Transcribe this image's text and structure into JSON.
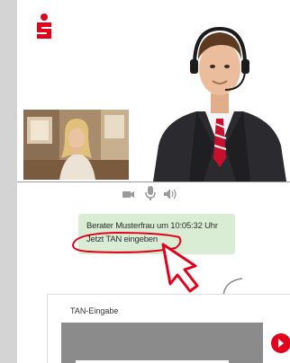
{
  "colors": {
    "brand": "#e2001a",
    "chat_bubble": "#d9ecd4",
    "tan_box": "#8b8b8b",
    "annotation": "#e2001a"
  },
  "logo": {
    "icon": "sparkasse-logo"
  },
  "video": {
    "controls": [
      {
        "icon": "camera-icon"
      },
      {
        "icon": "microphone-icon"
      },
      {
        "icon": "speaker-icon"
      }
    ]
  },
  "chat": {
    "message_line1": "Berater Musterfrau um 10:05:32 Uhr",
    "message_line2": "Jetzt TAN eingeben"
  },
  "tan": {
    "title": "TAN-Eingabe",
    "input_value": "",
    "submit_icon": "arrow-right-icon"
  }
}
